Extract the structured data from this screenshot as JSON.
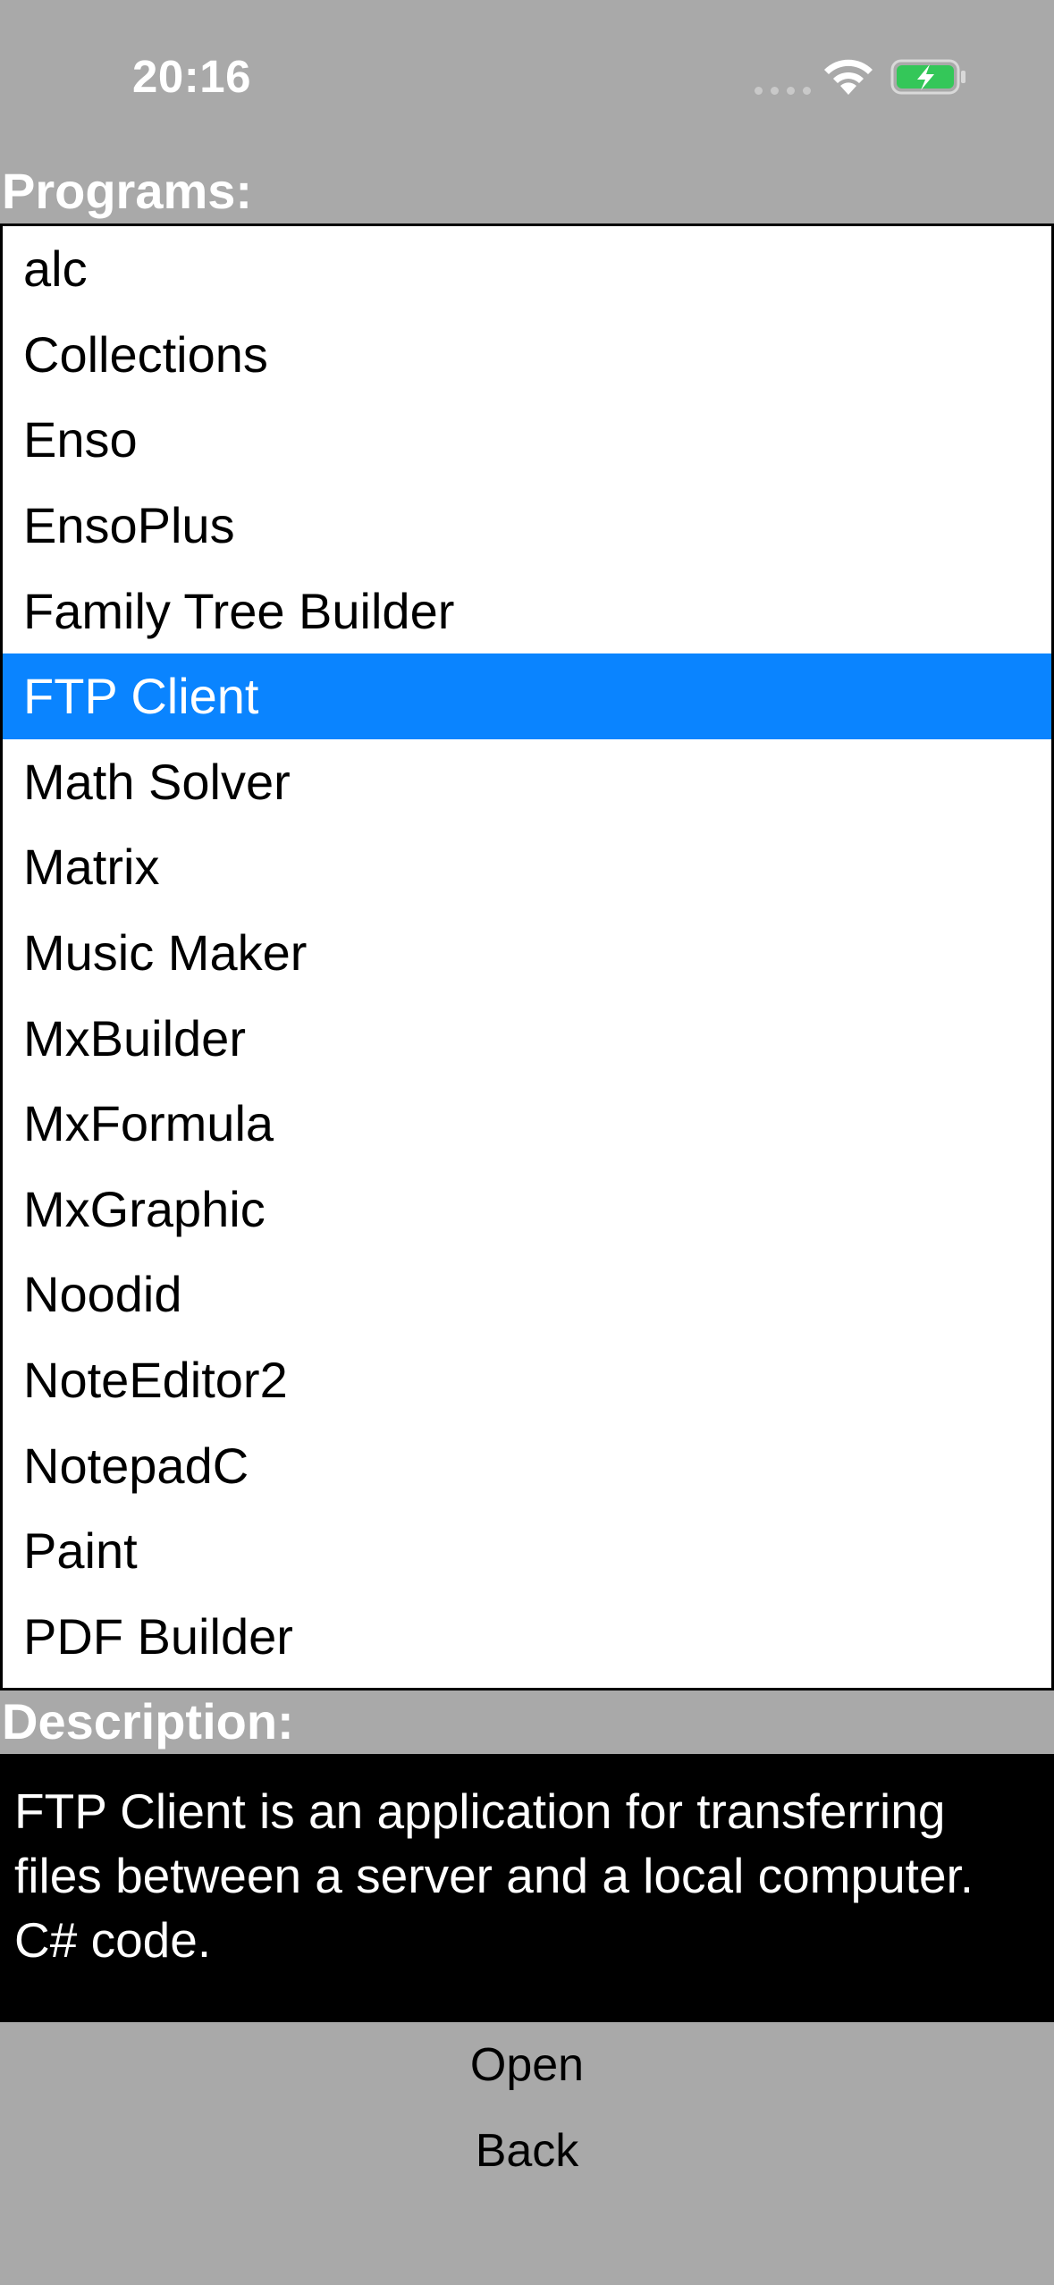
{
  "status_bar": {
    "time": "20:16",
    "wifi_icon": "wifi-icon",
    "battery_icon": "battery-charging-icon",
    "battery_color": "#34c759"
  },
  "programs": {
    "label": "Programs:",
    "items": [
      "alc",
      "Collections",
      "Enso",
      "EnsoPlus",
      "Family Tree Builder",
      "FTP Client",
      "Math Solver",
      "Matrix",
      "Music Maker",
      "MxBuilder",
      "MxFormula",
      "MxGraphic",
      "Noodid",
      "NoteEditor2",
      "NotepadC",
      "Paint",
      "PDF Builder"
    ],
    "selected": "FTP Client",
    "selection_color": "#0a84ff"
  },
  "description": {
    "label": "Description:",
    "text": "FTP Client is an application for transferring\nfiles between a server and a local computer.\nC# code."
  },
  "actions": {
    "open_label": "Open",
    "back_label": "Back"
  }
}
